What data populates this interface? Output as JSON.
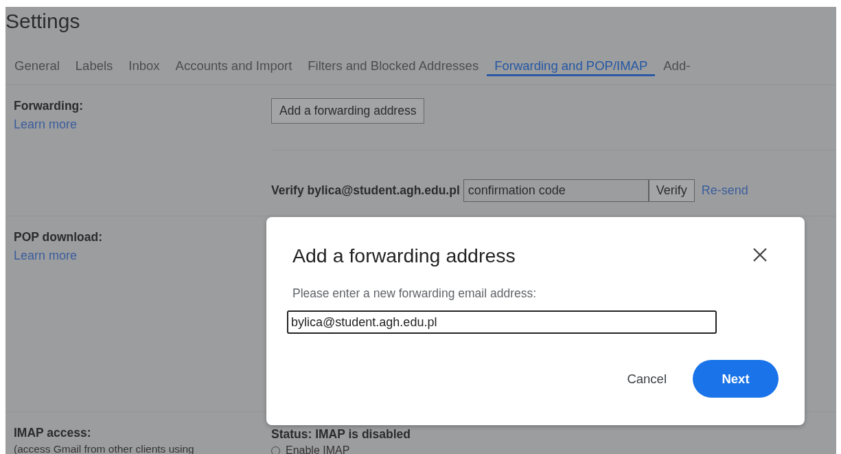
{
  "page_title": "Settings",
  "tabs": [
    {
      "label": "General",
      "selected": false
    },
    {
      "label": "Labels",
      "selected": false
    },
    {
      "label": "Inbox",
      "selected": false
    },
    {
      "label": "Accounts and Import",
      "selected": false
    },
    {
      "label": "Filters and Blocked Addresses",
      "selected": false
    },
    {
      "label": "Forwarding and POP/IMAP",
      "selected": true
    },
    {
      "label": "Add-",
      "selected": false
    }
  ],
  "sections": [
    {
      "kind": "forwarding",
      "label": "Forwarding:",
      "link": "Learn more",
      "button": "Add a forwarding address",
      "verify_label": "Verify bylica@student.agh.edu.pl",
      "code_placeholder": "confirmation code",
      "verify_button": "Verify",
      "resend_link": "Re-send"
    },
    {
      "kind": "pop",
      "label": "POP download:",
      "link": "Learn more"
    },
    {
      "kind": "imap",
      "label": "IMAP access:",
      "note": "(access Gmail from other clients using",
      "status": "Status: IMAP is disabled",
      "options": [
        {
          "label": "Enable IMAP",
          "selected": false
        }
      ]
    }
  ],
  "dialog": {
    "title": "Add a forwarding address",
    "prompt": "Please enter a new forwarding email address:",
    "email_value": "bylica@student.agh.edu.pl",
    "buttons": [
      {
        "label": "Cancel",
        "kind": "text"
      },
      {
        "label": "Next",
        "kind": "primary"
      }
    ]
  }
}
